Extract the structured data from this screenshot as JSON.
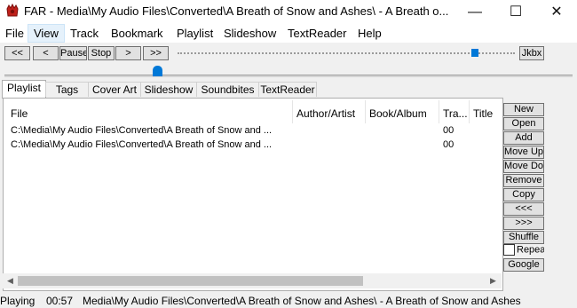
{
  "window": {
    "title": "FAR - Media\\My Audio Files\\Converted\\A Breath of Snow and Ashes\\ - A Breath o...",
    "minimize": "—",
    "maximize": "☐",
    "close": "✕",
    "icon": "far-app-icon"
  },
  "menu": {
    "file": "File",
    "view": "View",
    "track": "Track",
    "bookmark": "Bookmark",
    "playlist": "Playlist",
    "slideshow": "Slideshow",
    "textreader": "TextReader",
    "help": "Help"
  },
  "toolbar": {
    "rewind_fast": "<<",
    "rewind": "<",
    "pause": "Pause",
    "stop": "Stop",
    "forward": ">",
    "forward_fast": ">>",
    "jukebox": "Jkbx"
  },
  "tabs": {
    "playlist": "Playlist",
    "tags": "Tags",
    "cover_art": "Cover Art",
    "slideshow": "Slideshow",
    "soundbites": "Soundbites",
    "textreader": "TextReader"
  },
  "playlist": {
    "columns": [
      "File",
      "Author/Artist",
      "Book/Album",
      "Tra...",
      "Title"
    ],
    "rows": [
      [
        "C:\\Media\\My Audio Files\\Converted\\A Breath of Snow and ...",
        "",
        "",
        "00",
        ""
      ],
      [
        "C:\\Media\\My Audio Files\\Converted\\A Breath of Snow and ...",
        "",
        "",
        "00",
        ""
      ]
    ]
  },
  "side_buttons": {
    "new": "New",
    "open": "Open",
    "add": "Add",
    "move_up": "Move Up",
    "move_down": "Move Down",
    "remove": "Remove",
    "copy": "Copy",
    "prev": "<<<",
    "next": ">>>",
    "shuffle": "Shuffle",
    "repeat": "Repeat",
    "google": "Google"
  },
  "status": {
    "state": "Playing",
    "time": "00:57",
    "path": "Media\\My Audio Files\\Converted\\A Breath of Snow and Ashes\\ - A Breath of Snow and Ashes"
  },
  "colors": {
    "accent": "#0078d7",
    "window_bg": "#f0f0f0",
    "icon_red": "#c0201a"
  }
}
